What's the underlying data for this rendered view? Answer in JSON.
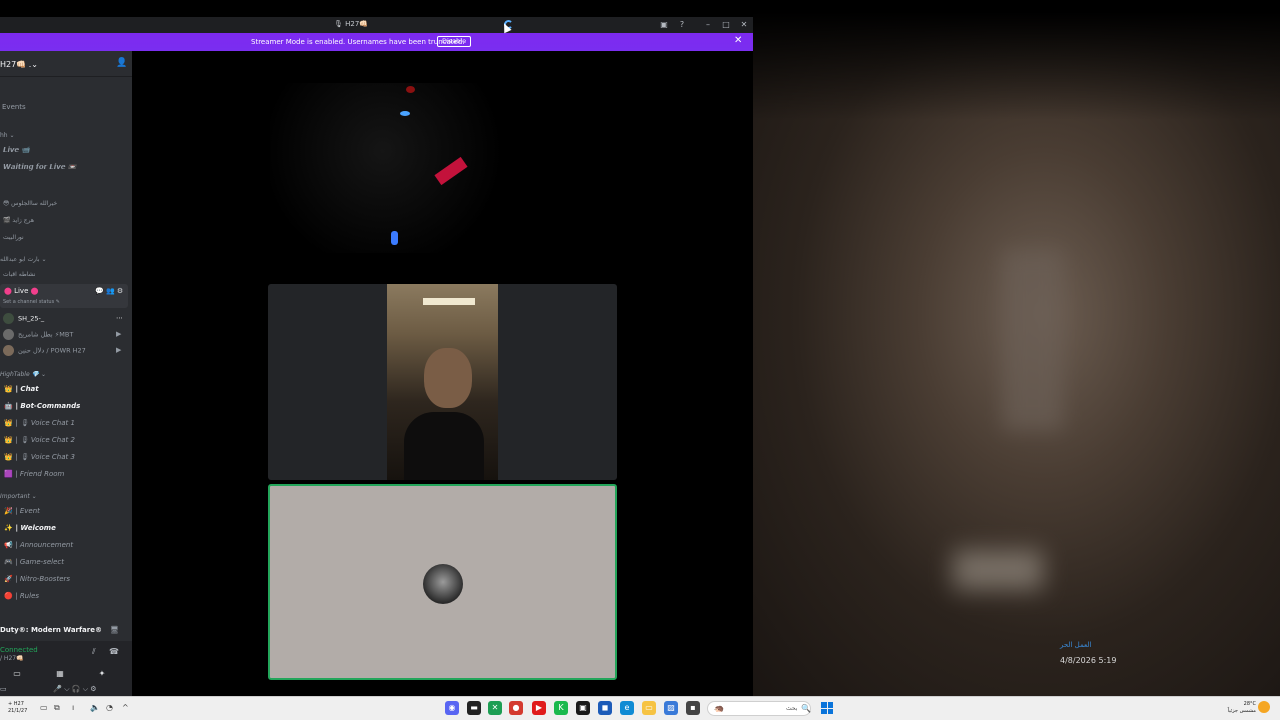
{
  "window": {
    "title": "H27👊🏻",
    "title_prefix": "🎙",
    "streamer_banner": "Streamer Mode is enabled. Usernames have been truncated.",
    "disable_label": "Disable"
  },
  "sidebar": {
    "server_name": "H27👊🏻 .⌄",
    "events_label": "Events",
    "rows": [
      {
        "text": "hh ⌄",
        "kind": "cat"
      },
      {
        "text": "𝙇𝙞𝙫𝙚 📹",
        "kind": "chan"
      },
      {
        "text": "𝙒𝙖𝙞𝙩𝙞𝙣𝙜 𝙛𝙤𝙧 𝙇𝙞𝙫𝙚 📼",
        "kind": "chan"
      },
      {
        "text": "😳 خيرالله ساالجلوس",
        "kind": "chan"
      },
      {
        "text": "🎬 هرج زايد",
        "kind": "chan"
      },
      {
        "text": "نورالبيت",
        "kind": "chan"
      },
      {
        "text": "بارت ابو عبدالله ⌄",
        "kind": "cat"
      },
      {
        "text": "نشاطه اقبات",
        "kind": "chan"
      }
    ],
    "voice": {
      "channel_label": "Live",
      "status": "Set a channel status ✎",
      "users": [
        {
          "name": "SH_25-_"
        },
        {
          "name": "بطل شامريح ⚡MBT"
        },
        {
          "name": "دلال حنين / POWR H27"
        }
      ]
    },
    "categories": [
      {
        "name": "HighTable 💎 ⌄",
        "channels": [
          {
            "label": "| Chat",
            "icon": "👑",
            "bold": true
          },
          {
            "label": "| Bot-Commands",
            "icon": "🤖",
            "bold": true
          },
          {
            "label": "| 🎙 Voice Chat 1",
            "icon": "👑",
            "bold": false
          },
          {
            "label": "| 🎙 Voice Chat 2",
            "icon": "👑",
            "bold": false
          },
          {
            "label": "| 🎙 Voice Chat 3",
            "icon": "👑",
            "bold": false
          },
          {
            "label": "| Friend Room",
            "icon": "🟪",
            "bold": false
          }
        ]
      },
      {
        "name": "Important ⌄",
        "channels": [
          {
            "label": "| Event",
            "icon": "🎉",
            "bold": false
          },
          {
            "label": "| Welcome",
            "icon": "✨",
            "bold": true
          },
          {
            "label": "| Announcement",
            "icon": "📢",
            "bold": false
          },
          {
            "label": "| Game-select",
            "icon": "🎮",
            "bold": false
          },
          {
            "label": "| Nitro-Boosters",
            "icon": "🚀",
            "bold": false
          },
          {
            "label": "| Rules",
            "icon": "🔴",
            "bold": false
          }
        ]
      }
    ],
    "user_panel": {
      "game": "Duty®: Modern Warfare®",
      "connection": "Connected",
      "connection_sub": "/ H27👊🏻"
    }
  },
  "desktop": {
    "widget_title": "العمل الحر",
    "widget_date": "4/8/2026 5:19"
  },
  "taskbar": {
    "left_time": "+ H27\n21/1/27",
    "search_text": "بحث",
    "weather": "28°C\nمشمس جزئياً"
  },
  "colors": {
    "banner": "#7d2af0",
    "sidebar": "#2b2d31",
    "connected": "#23a55a",
    "speaking_border": "#23a55a"
  }
}
